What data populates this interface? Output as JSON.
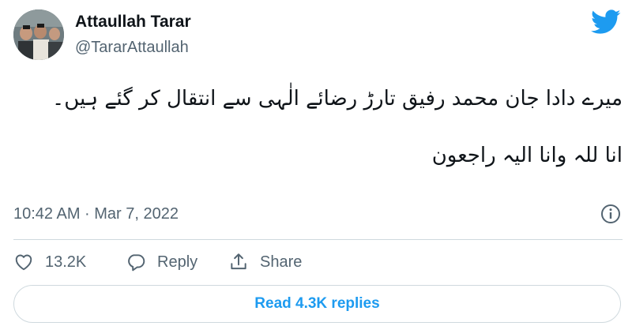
{
  "author": {
    "name": "Attaullah Tarar",
    "handle": "@TararAttaullah"
  },
  "tweet": {
    "paragraphs": [
      "میرے دادا جان محمد رفیق تارڑ رضائے الٰہی سے انتقال کر گئے ہیں۔",
      "انا للہ وانا الیہ راجعون"
    ],
    "timestamp": "10:42 AM · Mar 7, 2022"
  },
  "actions": {
    "like_count": "13.2K",
    "reply_label": "Reply",
    "share_label": "Share"
  },
  "read_replies_label": "Read 4.3K replies",
  "colors": {
    "brand_blue": "#1d9bf0",
    "text_primary": "#0f1419",
    "text_secondary": "#536471",
    "border": "#cfd9de"
  },
  "icons": [
    "twitter-bird-icon",
    "info-icon",
    "heart-icon",
    "reply-icon",
    "share-icon"
  ]
}
